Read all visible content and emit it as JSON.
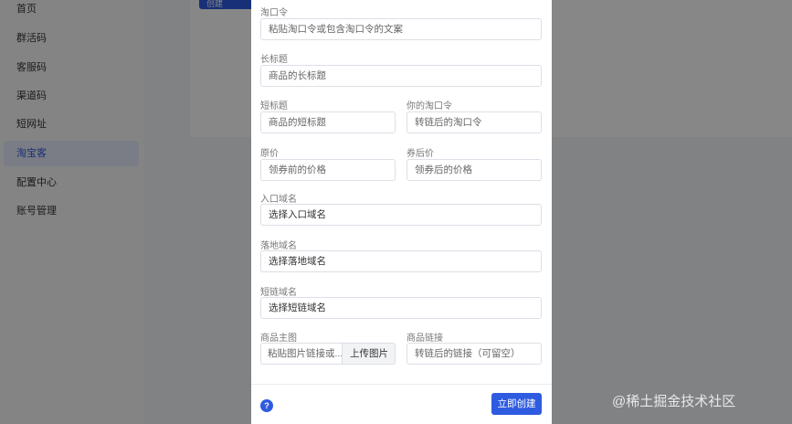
{
  "sidebar": {
    "items": [
      {
        "label": "首页"
      },
      {
        "label": "群活码"
      },
      {
        "label": "客服码"
      },
      {
        "label": "渠道码"
      },
      {
        "label": "短网址"
      },
      {
        "label": "淘宝客",
        "active": true
      },
      {
        "label": "配置中心"
      },
      {
        "label": "账号管理"
      }
    ]
  },
  "background": {
    "create_button_label": "创建"
  },
  "modal": {
    "tkl": {
      "label": "淘口令",
      "placeholder": "粘贴淘口令或包含淘口令的文案"
    },
    "long_title": {
      "label": "长标题",
      "placeholder": "商品的长标题"
    },
    "short_title": {
      "label": "短标题",
      "placeholder": "商品的短标题"
    },
    "your_tkl": {
      "label": "你的淘口令",
      "placeholder": "转链后的淘口令"
    },
    "original_price": {
      "label": "原价",
      "placeholder": "领券前的价格"
    },
    "coupon_price": {
      "label": "券后价",
      "placeholder": "领券后的价格"
    },
    "entry_domain": {
      "label": "入口域名",
      "value": "选择入口域名"
    },
    "landing_domain": {
      "label": "落地域名",
      "value": "选择落地域名"
    },
    "short_domain": {
      "label": "短链域名",
      "value": "选择短链域名"
    },
    "main_image": {
      "label": "商品主图",
      "placeholder": "粘贴图片链接或...",
      "upload_label": "上传图片"
    },
    "product_link": {
      "label": "商品链接",
      "placeholder": "转链后的链接（可留空）"
    },
    "help_icon": "question-circle-icon",
    "submit_label": "立即创建"
  },
  "watermark": "@稀土掘金技术社区",
  "colors": {
    "primary": "#2f5be0",
    "overlay": "rgba(0,0,0,0.47)"
  }
}
